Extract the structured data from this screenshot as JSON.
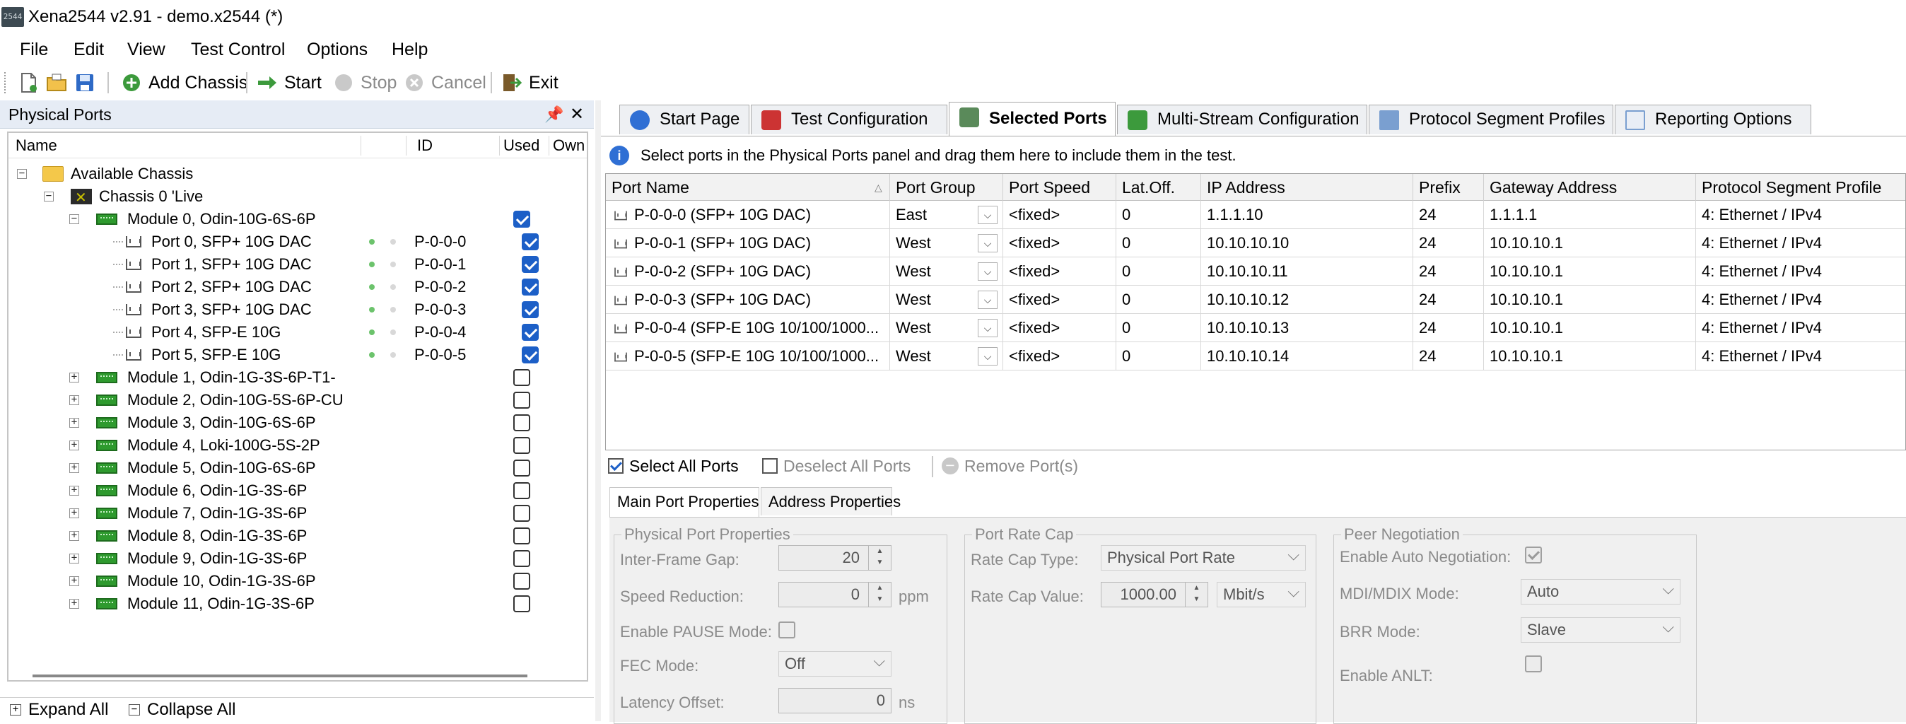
{
  "window": {
    "title": "Xena2544 v2.91 - demo.x2544 (*)",
    "app_icon_text": "2544"
  },
  "menu": [
    "File",
    "Edit",
    "View",
    "Test Control",
    "Options",
    "Help"
  ],
  "toolbar": {
    "add_chassis": "Add Chassis",
    "start": "Start",
    "stop": "Stop",
    "cancel": "Cancel",
    "exit": "Exit"
  },
  "left_panel": {
    "title": "Physical Ports",
    "columns": {
      "name": "Name",
      "id": "ID",
      "used": "Used",
      "owner": "Own"
    },
    "root": "Available Chassis",
    "chassis": "Chassis 0 'Live",
    "module0": "Module 0, Odin-10G-6S-6P",
    "ports": [
      {
        "name": "Port 0, SFP+ 10G DAC",
        "id": "P-0-0-0"
      },
      {
        "name": "Port 1, SFP+ 10G DAC",
        "id": "P-0-0-1"
      },
      {
        "name": "Port 2, SFP+ 10G DAC",
        "id": "P-0-0-2"
      },
      {
        "name": "Port 3, SFP+ 10G DAC",
        "id": "P-0-0-3"
      },
      {
        "name": "Port 4, SFP-E 10G",
        "id": "P-0-0-4"
      },
      {
        "name": "Port 5, SFP-E 10G",
        "id": "P-0-0-5"
      }
    ],
    "modules": [
      "Module 1, Odin-1G-3S-6P-T1-",
      "Module 2, Odin-10G-5S-6P-CU",
      "Module 3, Odin-10G-6S-6P",
      "Module 4, Loki-100G-5S-2P",
      "Module 5, Odin-10G-6S-6P",
      "Module 6, Odin-1G-3S-6P",
      "Module 7, Odin-1G-3S-6P",
      "Module 8, Odin-1G-3S-6P",
      "Module 9, Odin-1G-3S-6P",
      "Module 10, Odin-1G-3S-6P",
      "Module 11, Odin-1G-3S-6P"
    ],
    "expand_all": "Expand All",
    "collapse_all": "Collapse All"
  },
  "tabs": [
    "Start Page",
    "Test Configuration",
    "Selected Ports",
    "Multi-Stream Configuration",
    "Protocol Segment Profiles",
    "Reporting Options"
  ],
  "active_tab": "Selected Ports",
  "info_text": "Select ports in the Physical Ports panel and drag them here to include them in the test.",
  "grid": {
    "columns": [
      "Port Name",
      "Port Group",
      "Port Speed",
      "Lat.Off.",
      "IP Address",
      "Prefix",
      "Gateway Address",
      "Protocol Segment Profile"
    ],
    "rows": [
      {
        "name": "P-0-0-0 (SFP+ 10G DAC)",
        "group": "East",
        "speed": "<fixed>",
        "lat": "0",
        "ip": "1.1.1.10",
        "prefix": "24",
        "gw": "1.1.1.1",
        "profile": "4: Ethernet / IPv4"
      },
      {
        "name": "P-0-0-1 (SFP+ 10G DAC)",
        "group": "West",
        "speed": "<fixed>",
        "lat": "0",
        "ip": "10.10.10.10",
        "prefix": "24",
        "gw": "10.10.10.1",
        "profile": "4: Ethernet / IPv4"
      },
      {
        "name": "P-0-0-2 (SFP+ 10G DAC)",
        "group": "West",
        "speed": "<fixed>",
        "lat": "0",
        "ip": "10.10.10.11",
        "prefix": "24",
        "gw": "10.10.10.1",
        "profile": "4: Ethernet / IPv4"
      },
      {
        "name": "P-0-0-3 (SFP+ 10G DAC)",
        "group": "West",
        "speed": "<fixed>",
        "lat": "0",
        "ip": "10.10.10.12",
        "prefix": "24",
        "gw": "10.10.10.1",
        "profile": "4: Ethernet / IPv4"
      },
      {
        "name": "P-0-0-4 (SFP-E 10G 10/100/1000...",
        "group": "West",
        "speed": "<fixed>",
        "lat": "0",
        "ip": "10.10.10.13",
        "prefix": "24",
        "gw": "10.10.10.1",
        "profile": "4: Ethernet / IPv4"
      },
      {
        "name": "P-0-0-5 (SFP-E 10G 10/100/1000...",
        "group": "West",
        "speed": "<fixed>",
        "lat": "0",
        "ip": "10.10.10.14",
        "prefix": "24",
        "gw": "10.10.10.1",
        "profile": "4: Ethernet / IPv4"
      }
    ]
  },
  "selection": {
    "select_all": "Select All Ports",
    "deselect_all": "Deselect All Ports",
    "remove": "Remove Port(s)"
  },
  "subtabs": [
    "Main Port Properties",
    "Address Properties"
  ],
  "physical": {
    "title": "Physical Port Properties",
    "ifg_label": "Inter-Frame Gap:",
    "ifg_value": "20",
    "speed_red_label": "Speed Reduction:",
    "speed_red_value": "0",
    "speed_red_unit": "ppm",
    "pause_label": "Enable PAUSE Mode:",
    "fec_label": "FEC Mode:",
    "fec_value": "Off",
    "latency_label": "Latency Offset:",
    "latency_value": "0",
    "latency_unit": "ns"
  },
  "ratecap": {
    "title": "Port Rate Cap",
    "type_label": "Rate Cap Type:",
    "type_value": "Physical Port Rate",
    "value_label": "Rate Cap Value:",
    "value_value": "1000.00",
    "unit_value": "Mbit/s"
  },
  "peer": {
    "title": "Peer Negotiation",
    "auto_label": "Enable Auto Negotiation:",
    "mdi_label": "MDI/MDIX Mode:",
    "mdi_value": "Auto",
    "brr_label": "BRR Mode:",
    "brr_value": "Slave",
    "anlt_label": "Enable ANLT:"
  }
}
